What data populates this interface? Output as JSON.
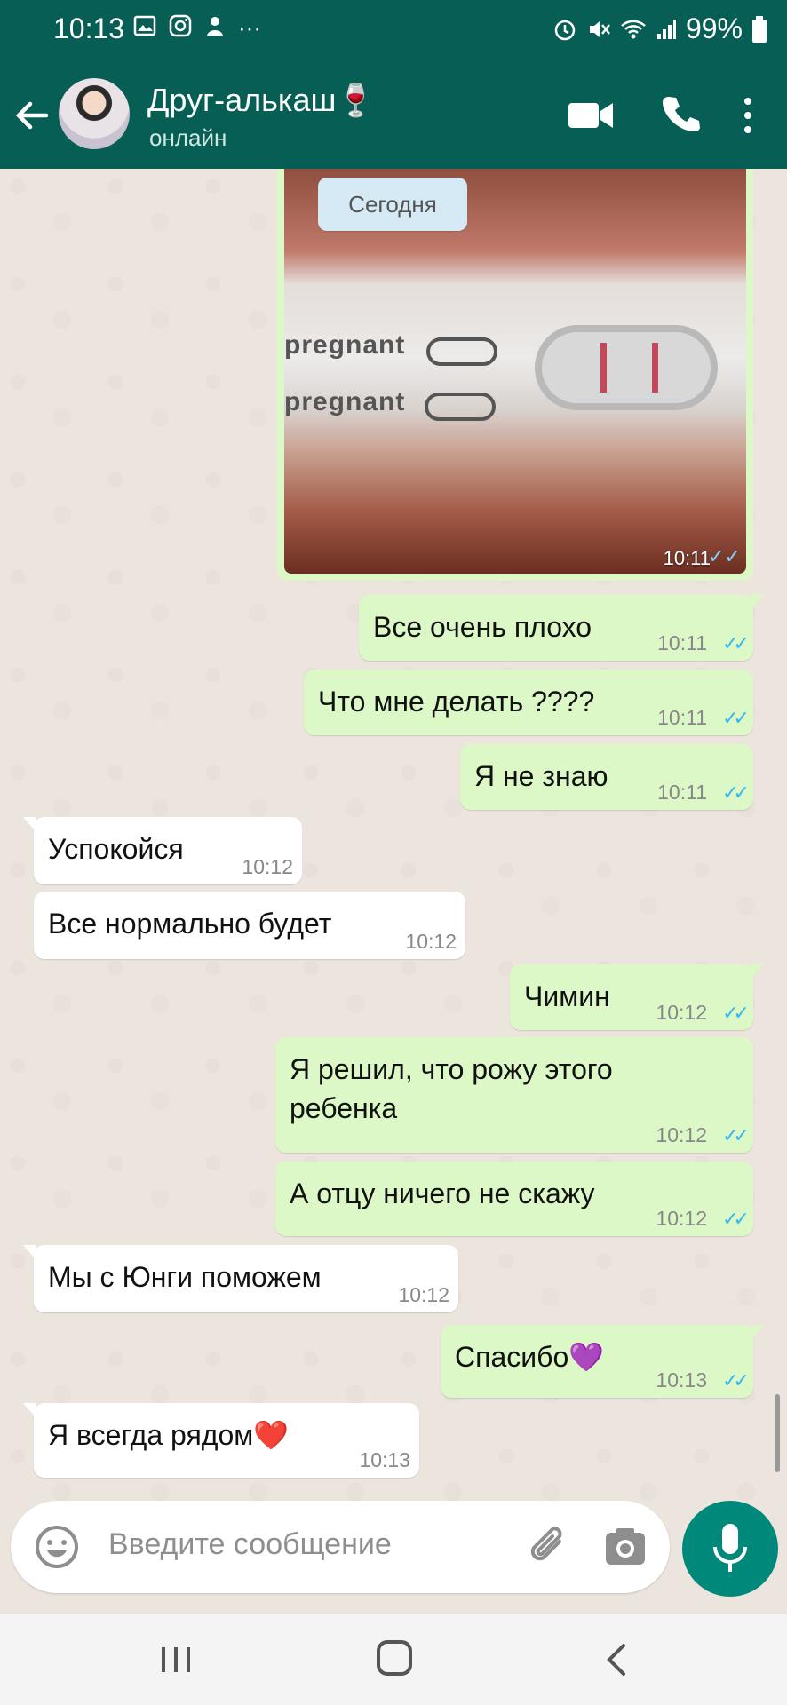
{
  "status_bar": {
    "time": "10:13",
    "left_icons": [
      "gallery-icon",
      "instagram-icon",
      "app-icon",
      "more-icon"
    ],
    "more_glyph": "···",
    "battery": "99%"
  },
  "header": {
    "contact_name": "Друг-алькаш🍷",
    "contact_status": "онлайн"
  },
  "chat": {
    "date_label": "Сегодня",
    "photo_message": {
      "time": "10:11",
      "ticks": "✓✓",
      "photo_text_line1": "pregnant",
      "photo_text_line2": "pregnant"
    },
    "messages": [
      {
        "dir": "out",
        "text": "Все очень плохо",
        "time": "10:11"
      },
      {
        "dir": "out",
        "text": "Что мне делать ????",
        "time": "10:11"
      },
      {
        "dir": "out",
        "text": "Я не знаю",
        "time": "10:11"
      },
      {
        "dir": "in",
        "text": "Успокойся",
        "time": "10:12"
      },
      {
        "dir": "in",
        "text": "Все нормально будет",
        "time": "10:12"
      },
      {
        "dir": "out",
        "text": "Чимин",
        "time": "10:12"
      },
      {
        "dir": "out",
        "text": "Я решил, что рожу этого\nребенка",
        "time": "10:12"
      },
      {
        "dir": "out",
        "text": "А отцу ничего не скажу",
        "time": "10:12"
      },
      {
        "dir": "in",
        "text": "Мы с Юнги поможем",
        "time": "10:12"
      },
      {
        "dir": "out",
        "text": "Спасибо💜",
        "time": "10:13"
      },
      {
        "dir": "in",
        "text": "Я всегда рядом❤️",
        "time": "10:13"
      }
    ],
    "ticks": "✓✓"
  },
  "input": {
    "placeholder": "Введите сообщение"
  },
  "colors": {
    "header": "#075e54",
    "outgoing_bubble": "#dcf8c6",
    "incoming_bubble": "#ffffff",
    "read_ticks": "#34b7f1",
    "mic_button": "#00897b"
  }
}
